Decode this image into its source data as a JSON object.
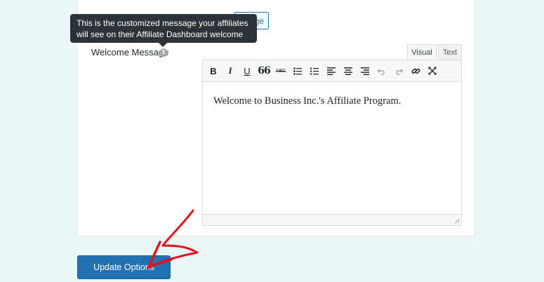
{
  "partial_button": {
    "label": "ge"
  },
  "tooltip": {
    "text": "This is the customized message your affiliates will see on their Affiliate Dashboard welcome page."
  },
  "field": {
    "label": "Welcome Message",
    "info_icon": "i"
  },
  "editor": {
    "tabs": [
      {
        "label": "Visual",
        "active": true
      },
      {
        "label": "Text",
        "active": false
      }
    ],
    "toolbar": [
      {
        "name": "bold-icon",
        "glyph": "B"
      },
      {
        "name": "italic-icon",
        "glyph": "I"
      },
      {
        "name": "underline-icon",
        "glyph": "U"
      },
      {
        "name": "blockquote-icon",
        "glyph": "66"
      },
      {
        "name": "strikethrough-icon",
        "glyph": "ABC"
      },
      {
        "name": "bullet-list-icon"
      },
      {
        "name": "numbered-list-icon"
      },
      {
        "name": "align-left-icon"
      },
      {
        "name": "align-center-icon"
      },
      {
        "name": "align-right-icon"
      },
      {
        "name": "undo-icon"
      },
      {
        "name": "redo-icon"
      },
      {
        "name": "link-icon"
      },
      {
        "name": "fullscreen-icon"
      }
    ],
    "content": "Welcome to Business Inc.'s Affiliate Program."
  },
  "submit": {
    "label": "Update Options"
  },
  "colors": {
    "accent": "#2271b1",
    "tooltip_bg": "#2c3338",
    "annotation": "#e0141e",
    "page_bg": "#eaf6f7"
  }
}
